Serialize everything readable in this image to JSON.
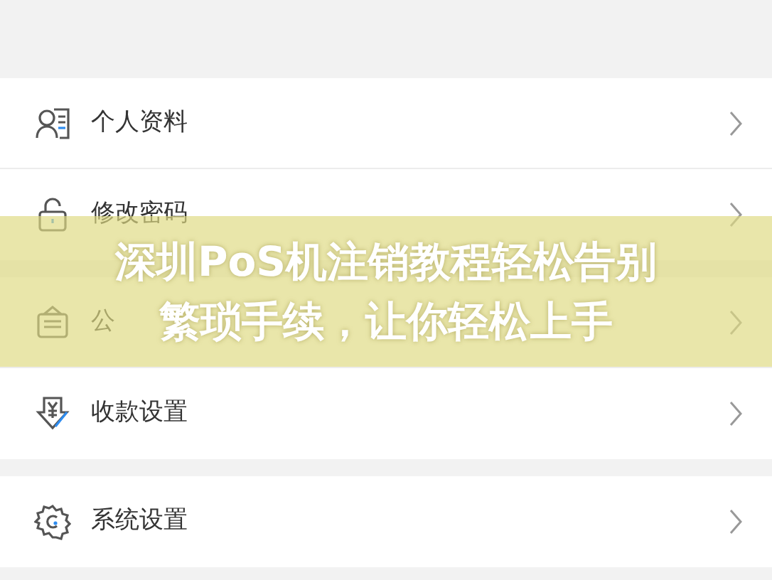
{
  "groups": [
    {
      "items": [
        {
          "kind": "profile",
          "label": "个人资料"
        },
        {
          "kind": "lock",
          "label": "修改密码"
        }
      ]
    },
    {
      "items": [
        {
          "kind": "notice",
          "label": "公"
        },
        {
          "kind": "payment",
          "label": "收款设置"
        }
      ]
    },
    {
      "items": [
        {
          "kind": "settings",
          "label": "系统设置"
        }
      ]
    }
  ],
  "overlay_title": [
    "深圳PoS机注销教程轻松告别",
    "繁琐手续，让你轻松上手"
  ]
}
